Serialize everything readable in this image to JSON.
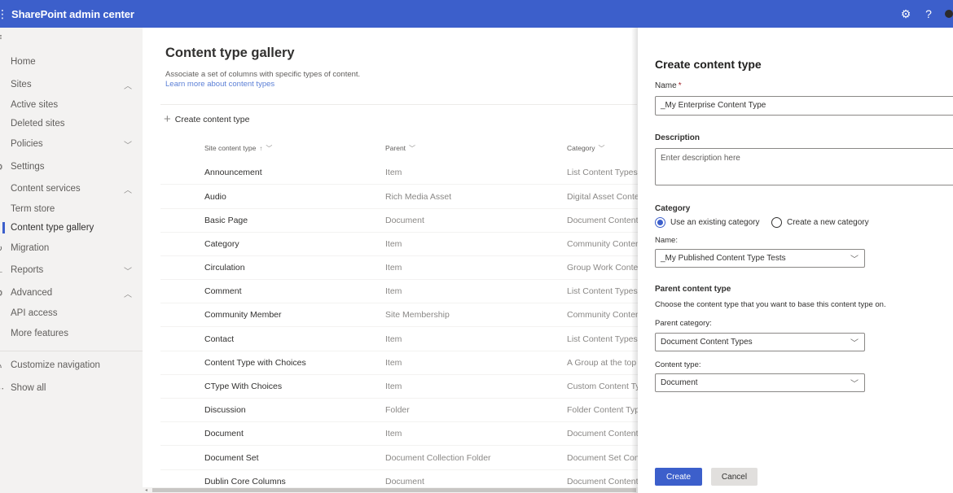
{
  "topbar": {
    "app_title": "SharePoint admin center",
    "waffle_icon": "⋮",
    "settings_icon": "⚙",
    "help_icon": "?"
  },
  "nav": {
    "collapse_icon": "≡",
    "items": [
      {
        "label": "Home",
        "icon": "⌂"
      },
      {
        "label": "Sites",
        "icon": "▯",
        "chevron": "︿"
      },
      {
        "label": "Active sites"
      },
      {
        "label": "Deleted sites"
      },
      {
        "label": "Policies",
        "icon": "▯",
        "chevron": "﹀"
      },
      {
        "label": "Settings",
        "icon": "⚙"
      },
      {
        "label": "Content services",
        "icon": "▯",
        "chevron": "︿"
      },
      {
        "label": "Term store"
      },
      {
        "label": "Content type gallery"
      },
      {
        "label": "Migration",
        "icon": "↻"
      },
      {
        "label": "Reports",
        "icon": "∟",
        "chevron": "﹀"
      },
      {
        "label": "Advanced",
        "icon": "⚙",
        "chevron": "︿"
      },
      {
        "label": "API access"
      },
      {
        "label": "More features"
      },
      {
        "label": "Customize navigation",
        "icon": "✎"
      },
      {
        "label": "Show all",
        "icon": "⋯"
      }
    ]
  },
  "main": {
    "title": "Content type gallery",
    "description": "Associate a set of columns with specific types of content.",
    "learn_more": "Learn more about content types",
    "create_cmd": "Create content type",
    "columns": {
      "name": "Site content type",
      "name_sort": "↑",
      "parent": "Parent",
      "category": "Category",
      "chev": "﹀"
    },
    "rows": [
      {
        "name": "Announcement",
        "parent": "Item",
        "category": "List Content Types"
      },
      {
        "name": "Audio",
        "parent": "Rich Media Asset",
        "category": "Digital Asset Content Types"
      },
      {
        "name": "Basic Page",
        "parent": "Document",
        "category": "Document Content Types"
      },
      {
        "name": "Category",
        "parent": "Item",
        "category": "Community Content Types"
      },
      {
        "name": "Circulation",
        "parent": "Item",
        "category": "Group Work Content Types"
      },
      {
        "name": "Comment",
        "parent": "Item",
        "category": "List Content Types"
      },
      {
        "name": "Community Member",
        "parent": "Site Membership",
        "category": "Community Content Types"
      },
      {
        "name": "Contact",
        "parent": "Item",
        "category": "List Content Types"
      },
      {
        "name": "Content Type with Choices",
        "parent": "Item",
        "category": "A Group at the top"
      },
      {
        "name": "CType With Choices",
        "parent": "Item",
        "category": "Custom Content Types"
      },
      {
        "name": "Discussion",
        "parent": "Folder",
        "category": "Folder Content Types"
      },
      {
        "name": "Document",
        "parent": "Item",
        "category": "Document Content Types"
      },
      {
        "name": "Document Set",
        "parent": "Document Collection Folder",
        "category": "Document Set Content Types"
      },
      {
        "name": "Dublin Core Columns",
        "parent": "Document",
        "category": "Document Content Types"
      }
    ]
  },
  "panel": {
    "title": "Create content type",
    "name_label": "Name",
    "required_mark": "*",
    "name_value": "_My Enterprise Content Type",
    "description_label": "Description",
    "description_placeholder": "Enter description here",
    "category_label": "Category",
    "radio_existing": "Use an existing category",
    "radio_new": "Create a new category",
    "category_name_label": "Name:",
    "category_name_value": "_My Published Content Type Tests",
    "parent_label": "Parent content type",
    "parent_help": "Choose the content type that you want to base this content type on.",
    "parent_category_label": "Parent category:",
    "parent_category_value": "Document Content Types",
    "content_type_label": "Content type:",
    "content_type_value": "Document",
    "dropdown_icon": "﹀",
    "create_button": "Create",
    "cancel_button": "Cancel"
  },
  "colors": {
    "accent": "#3c5fcb"
  }
}
